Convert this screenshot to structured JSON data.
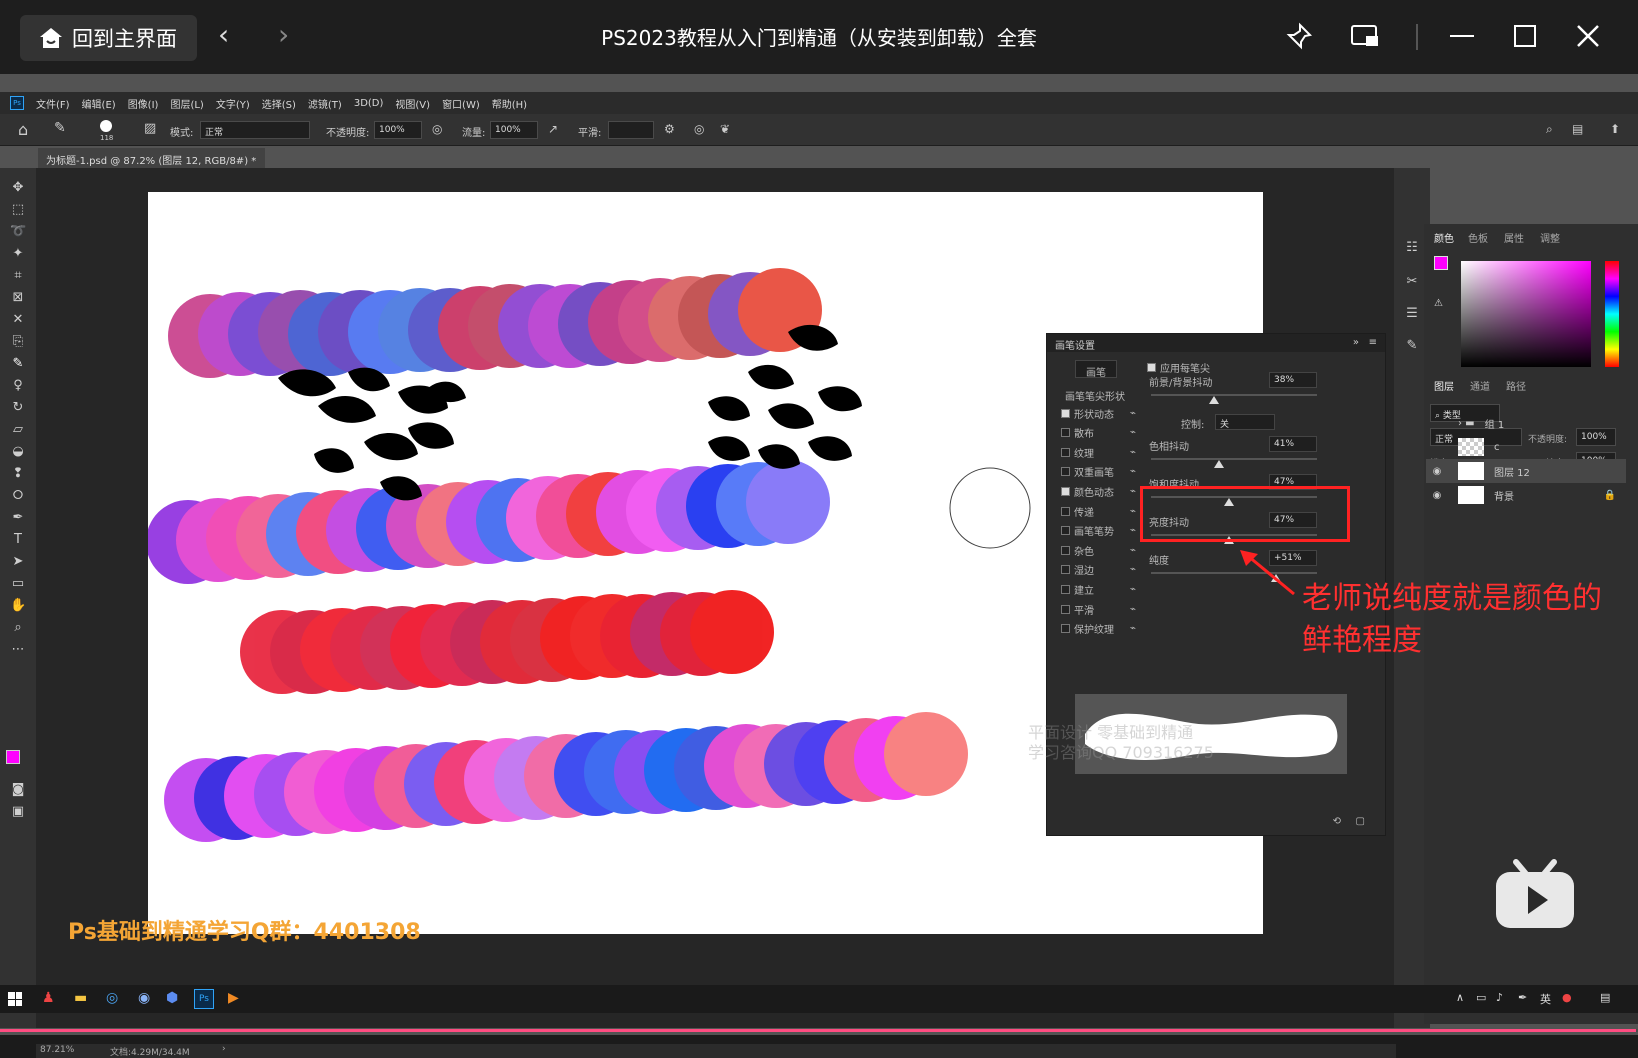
{
  "player": {
    "home_label": "回到主界面",
    "title": "PS2023教程从入门到精通（从安装到卸载）全套",
    "progress": 0.999
  },
  "ps": {
    "menu": [
      "文件(F)",
      "编辑(E)",
      "图像(I)",
      "图层(L)",
      "文字(Y)",
      "选择(S)",
      "滤镜(T)",
      "3D(D)",
      "视图(V)",
      "窗口(W)",
      "帮助(H)"
    ],
    "options": {
      "brush_size": "118",
      "mode_label": "模式:",
      "mode_value": "正常",
      "opacity_label": "不透明度:",
      "opacity_value": "100%",
      "flow_label": "流量:",
      "flow_value": "100%",
      "smooth_label": "平滑:"
    },
    "doc_tab": "为标题-1.psd @ 87.2% (图层 12, RGB/8#) *",
    "status_zoom": "87.21%",
    "status_doc": "文档:4.29M/34.4M"
  },
  "canvas": {
    "promo_text": "Ps基础到精通学习Q群：4401308",
    "watermark_line1": "平面设计  零基础到精通",
    "watermark_line2": "学习咨询QQ 709316275"
  },
  "brush_panel": {
    "title": "画笔设置",
    "brush_button": "画笔",
    "tip_shape": "画笔笔尖形状",
    "apply_per_tip": "应用每笔尖",
    "items": [
      {
        "label": "形状动态",
        "checked": true
      },
      {
        "label": "散布",
        "checked": false
      },
      {
        "label": "纹理",
        "checked": false
      },
      {
        "label": "双重画笔",
        "checked": false
      },
      {
        "label": "颜色动态",
        "checked": true
      },
      {
        "label": "传递",
        "checked": false
      },
      {
        "label": "画笔笔势",
        "checked": false
      },
      {
        "label": "杂色",
        "checked": false
      },
      {
        "label": "湿边",
        "checked": false
      },
      {
        "label": "建立",
        "checked": false
      },
      {
        "label": "平滑",
        "checked": false
      },
      {
        "label": "保护纹理",
        "checked": false
      }
    ],
    "sliders": [
      {
        "label": "前景/背景抖动",
        "value": "38%",
        "level": 0.38
      },
      {
        "label": "色相抖动",
        "value": "41%",
        "level": 0.41
      },
      {
        "label": "饱和度抖动",
        "value": "47%",
        "level": 0.47
      },
      {
        "label": "亮度抖动",
        "value": "47%",
        "level": 0.47
      },
      {
        "label": "纯度",
        "value": "+51%",
        "level": 0.755
      }
    ],
    "control_label": "控制:",
    "control_value": "关"
  },
  "annotation": {
    "line1": "老师说纯度就是颜色的",
    "line2": "鲜艳程度"
  },
  "right_panels": {
    "color_tabs": [
      "颜色",
      "色板",
      "属性",
      "调整"
    ],
    "layer_tabs": [
      "图层",
      "通道",
      "路径"
    ],
    "kind_label": "类型",
    "blend_mode": "正常",
    "opacity_label": "不透明度:",
    "opacity_value": "100%",
    "lock_label": "锁定:",
    "fill_label": "填充:",
    "fill_value": "100%",
    "layers": [
      {
        "name": "组 1",
        "visible": false
      },
      {
        "name": "c",
        "visible": false
      },
      {
        "name": "图层 12",
        "visible": true
      },
      {
        "name": "背景",
        "visible": true
      }
    ]
  },
  "taskbar": {
    "ime": "英"
  }
}
